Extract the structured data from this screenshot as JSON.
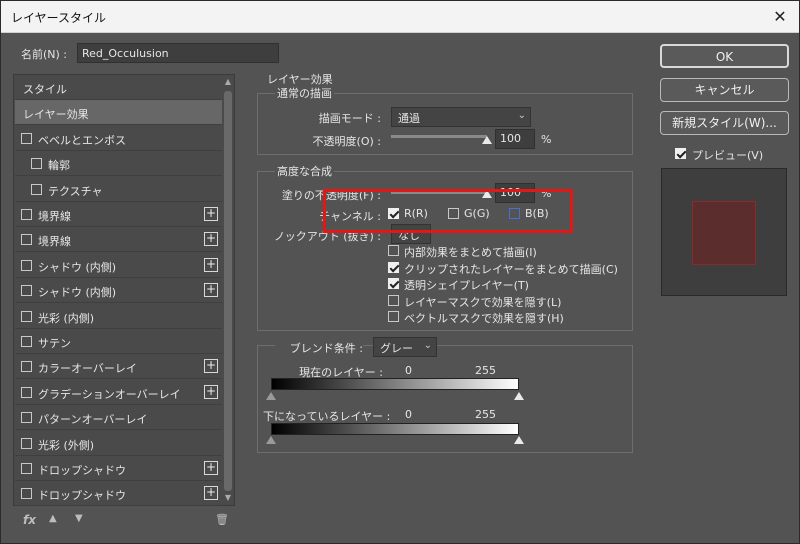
{
  "window": {
    "title": "レイヤースタイル",
    "close_glyph": "✕"
  },
  "name_field": {
    "label": "名前(N) :",
    "value": "Red_Occulusion"
  },
  "style_list": {
    "items": [
      {
        "label": "スタイル",
        "checkbox": false,
        "plus": false,
        "indent": 0
      },
      {
        "label": "レイヤー効果",
        "checkbox": false,
        "plus": false,
        "indent": 0,
        "selected": true
      },
      {
        "label": "ベベルとエンボス",
        "checkbox": true,
        "plus": false,
        "indent": 0
      },
      {
        "label": "輪郭",
        "checkbox": true,
        "plus": false,
        "indent": 1
      },
      {
        "label": "テクスチャ",
        "checkbox": true,
        "plus": false,
        "indent": 1
      },
      {
        "label": "境界線",
        "checkbox": true,
        "plus": true,
        "indent": 0
      },
      {
        "label": "境界線",
        "checkbox": true,
        "plus": true,
        "indent": 0
      },
      {
        "label": "シャドウ (内側)",
        "checkbox": true,
        "plus": true,
        "indent": 0
      },
      {
        "label": "シャドウ (内側)",
        "checkbox": true,
        "plus": true,
        "indent": 0
      },
      {
        "label": "光彩 (内側)",
        "checkbox": true,
        "plus": false,
        "indent": 0
      },
      {
        "label": "サテン",
        "checkbox": true,
        "plus": false,
        "indent": 0
      },
      {
        "label": "カラーオーバーレイ",
        "checkbox": true,
        "plus": true,
        "indent": 0
      },
      {
        "label": "グラデーションオーバーレイ",
        "checkbox": true,
        "plus": true,
        "indent": 0
      },
      {
        "label": "パターンオーバーレイ",
        "checkbox": true,
        "plus": false,
        "indent": 0
      },
      {
        "label": "光彩 (外側)",
        "checkbox": true,
        "plus": false,
        "indent": 0
      },
      {
        "label": "ドロップシャドウ",
        "checkbox": true,
        "plus": true,
        "indent": 0
      },
      {
        "label": "ドロップシャドウ",
        "checkbox": true,
        "plus": true,
        "indent": 0
      }
    ],
    "plus_glyph": "+",
    "footer_icons": {
      "fx": "fx",
      "up": "▲",
      "down": "▼",
      "trash": "🗑"
    }
  },
  "layer_effects": {
    "title": "レイヤー効果",
    "normal_blending": {
      "title": "通常の描画",
      "blend_mode_label": "描画モード :",
      "blend_mode_value": "通過",
      "opacity_label": "不透明度(O) :",
      "opacity_value": "100",
      "opacity_unit": "%"
    },
    "advanced_blending": {
      "title": "高度な合成",
      "fill_opacity_label": "塗りの不透明度(F) :",
      "fill_opacity_value": "100",
      "fill_opacity_unit": "%",
      "channels_label": "チャンネル :",
      "channels": [
        {
          "label": "R(R)",
          "checked": true
        },
        {
          "label": "G(G)",
          "checked": false
        },
        {
          "label": "B(B)",
          "checked": false
        }
      ],
      "knockout_label": "ノックアウト (抜き) :",
      "knockout_value": "なし",
      "options": [
        {
          "label": "内部効果をまとめて描画(I)",
          "checked": false
        },
        {
          "label": "クリップされたレイヤーをまとめて描画(C)",
          "checked": true
        },
        {
          "label": "透明シェイプレイヤー(T)",
          "checked": true
        },
        {
          "label": "レイヤーマスクで効果を隠す(L)",
          "checked": false
        },
        {
          "label": "ベクトルマスクで効果を隠す(H)",
          "checked": false
        }
      ]
    },
    "blend_if": {
      "label": "ブレンド条件 :",
      "value": "グレー",
      "this_layer_label": "現在のレイヤー :",
      "underlying_label": "下になっているレイヤー :",
      "min": "0",
      "max": "255"
    }
  },
  "buttons": {
    "ok": "OK",
    "cancel": "キャンセル",
    "new_style": "新規スタイル(W)..."
  },
  "preview": {
    "label": "プレビュー(V)",
    "checked": true,
    "swatch_color": "#5b2d2d"
  },
  "colors": {
    "highlight": "#e01818",
    "bg": "#535353"
  }
}
